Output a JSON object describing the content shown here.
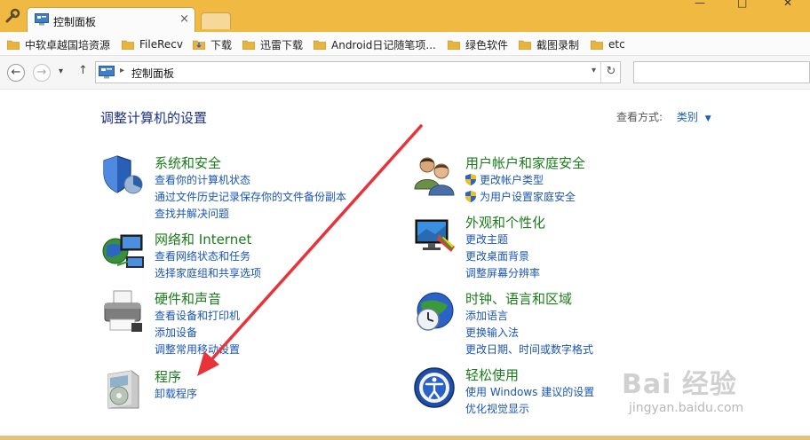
{
  "window": {
    "tab_title": "控制面板",
    "tab_close_glyph": "×",
    "minimize_glyph": "—",
    "maximize_glyph": "□",
    "close_glyph": "✕"
  },
  "bookmarks": [
    {
      "label": "中软卓越国培资源",
      "icon": "folder-icon"
    },
    {
      "label": "FileRecv",
      "icon": "folder-icon"
    },
    {
      "label": "下载",
      "icon": "download-folder-icon"
    },
    {
      "label": "迅雷下载",
      "icon": "folder-icon"
    },
    {
      "label": "Android日记随笔项...",
      "icon": "folder-icon"
    },
    {
      "label": "绿色软件",
      "icon": "folder-icon"
    },
    {
      "label": "截图录制",
      "icon": "folder-icon"
    },
    {
      "label": "etc",
      "icon": "folder-icon"
    }
  ],
  "nav": {
    "back_glyph": "←",
    "forward_glyph": "→",
    "history_glyph": "▾",
    "up_glyph": "↑",
    "breadcrumb_separator": "▸",
    "breadcrumb": "控制面板",
    "dropdown_glyph": "▾",
    "refresh_glyph": "↻",
    "search_placeholder": ""
  },
  "content": {
    "title": "调整计算机的设置",
    "view_by_label": "查看方式:",
    "view_by_value": "类别",
    "view_by_arrow": "▼",
    "categories": [
      {
        "title": "系统和安全",
        "icon": "shield-security-icon",
        "links": [
          "查看你的计算机状态",
          "通过文件历史记录保存你的文件备份副本",
          "查找并解决问题"
        ]
      },
      {
        "title": "网络和 Internet",
        "icon": "network-globe-icon",
        "links": [
          "查看网络状态和任务",
          "选择家庭组和共享选项"
        ]
      },
      {
        "title": "硬件和声音",
        "icon": "printer-icon",
        "links": [
          "查看设备和打印机",
          "添加设备",
          "调整常用移动设置"
        ]
      },
      {
        "title": "程序",
        "icon": "programs-box-icon",
        "links": [
          "卸载程序"
        ]
      },
      {
        "title": "用户帐户和家庭安全",
        "icon": "users-icon",
        "links": [
          "更改帐户类型",
          "为用户设置家庭安全"
        ]
      },
      {
        "title": "外观和个性化",
        "icon": "monitor-palette-icon",
        "links": [
          "更改主题",
          "更改桌面背景",
          "调整屏幕分辨率"
        ]
      },
      {
        "title": "时钟、语言和区域",
        "icon": "clock-globe-icon",
        "links": [
          "添加语言",
          "更换输入法",
          "更改日期、时间或数字格式"
        ]
      },
      {
        "title": "轻松使用",
        "icon": "ease-of-access-icon",
        "links": [
          "使用 Windows 建议的设置",
          "优化视觉显示"
        ]
      }
    ]
  },
  "watermark": {
    "main": "Bai 经验",
    "sub": "jingyan.baidu.com"
  },
  "colors": {
    "tab_strip": "#f0b942",
    "category_title": "#1b7c1b",
    "link": "#1a55b8",
    "page_title": "#1e3287",
    "annotation_arrow": "#e8333a"
  }
}
